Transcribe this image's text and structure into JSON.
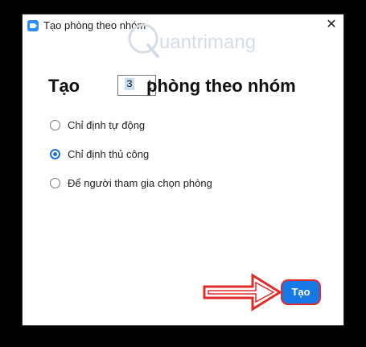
{
  "window": {
    "title": "Tạo phòng theo nhóm",
    "close_glyph": "✕"
  },
  "heading": {
    "prefix": "Tạo",
    "suffix": "phòng theo nhóm",
    "room_count": "3"
  },
  "options": [
    {
      "label": "Chỉ định tự động",
      "checked": false
    },
    {
      "label": "Chỉ định thủ công",
      "checked": true
    },
    {
      "label": "Để người tham gia chọn phòng",
      "checked": false
    }
  ],
  "actions": {
    "create_label": "Tạo"
  },
  "watermark": {
    "text": "uantrimang"
  },
  "colors": {
    "accent": "#1f6fd8",
    "button": "#1679e5",
    "annotation_red": "#e12a2a"
  },
  "icons": {
    "app": "zoom-app-icon",
    "close": "close-icon",
    "annotation": "red-arrow-icon"
  }
}
